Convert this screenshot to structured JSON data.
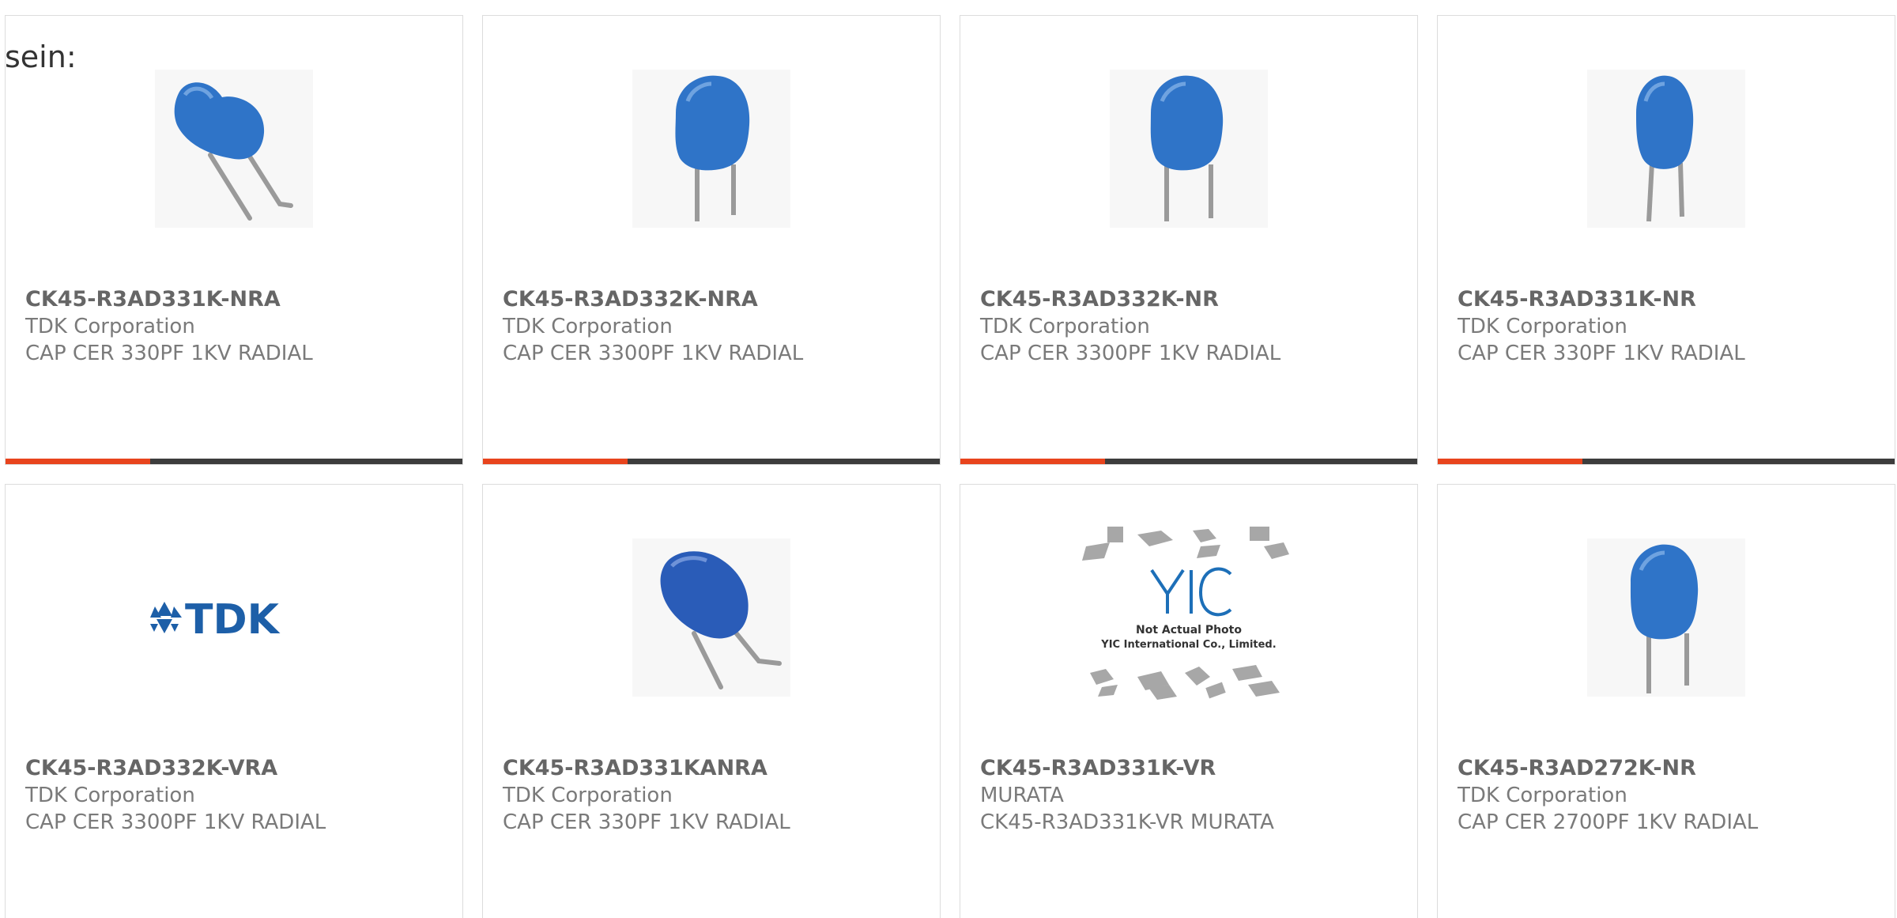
{
  "intro_text": "sein:",
  "colors": {
    "accent": "#e8441d",
    "bar_dark": "#3d3d3d",
    "capacitor_blue": "#2f74c8",
    "tdk_blue": "#1d5fa8"
  },
  "products": [
    {
      "part_number": "CK45-R3AD331K-NRA",
      "manufacturer": "TDK Corporation",
      "description": "CAP CER 330PF 1KV RADIAL",
      "image": "capacitor-bent-leads"
    },
    {
      "part_number": "CK45-R3AD332K-NRA",
      "manufacturer": "TDK Corporation",
      "description": "CAP CER 3300PF 1KV RADIAL",
      "image": "capacitor-straight-leads"
    },
    {
      "part_number": "CK45-R3AD332K-NR",
      "manufacturer": "TDK Corporation",
      "description": "CAP CER 3300PF 1KV RADIAL",
      "image": "capacitor-straight-leads"
    },
    {
      "part_number": "CK45-R3AD331K-NR",
      "manufacturer": "TDK Corporation",
      "description": "CAP CER 330PF 1KV RADIAL",
      "image": "capacitor-straight-leads"
    },
    {
      "part_number": "CK45-R3AD332K-VRA",
      "manufacturer": "TDK Corporation",
      "description": "CAP CER 3300PF 1KV RADIAL",
      "image": "tdk-logo",
      "logo_text": "TDK"
    },
    {
      "part_number": "CK45-R3AD331KANRA",
      "manufacturer": "TDK Corporation",
      "description": "CAP CER 330PF 1KV RADIAL",
      "image": "capacitor-bent-leads"
    },
    {
      "part_number": "CK45-R3AD331K-VR",
      "manufacturer": "MURATA",
      "description": "CK45-R3AD331K-VR MURATA",
      "image": "yic-placeholder",
      "placeholder_logo": "YIC",
      "placeholder_line1": "Not Actual Photo",
      "placeholder_line2": "YIC International Co., Limited."
    },
    {
      "part_number": "CK45-R3AD272K-NR",
      "manufacturer": "TDK Corporation",
      "description": "CAP CER 2700PF 1KV RADIAL",
      "image": "capacitor-straight-leads"
    }
  ]
}
